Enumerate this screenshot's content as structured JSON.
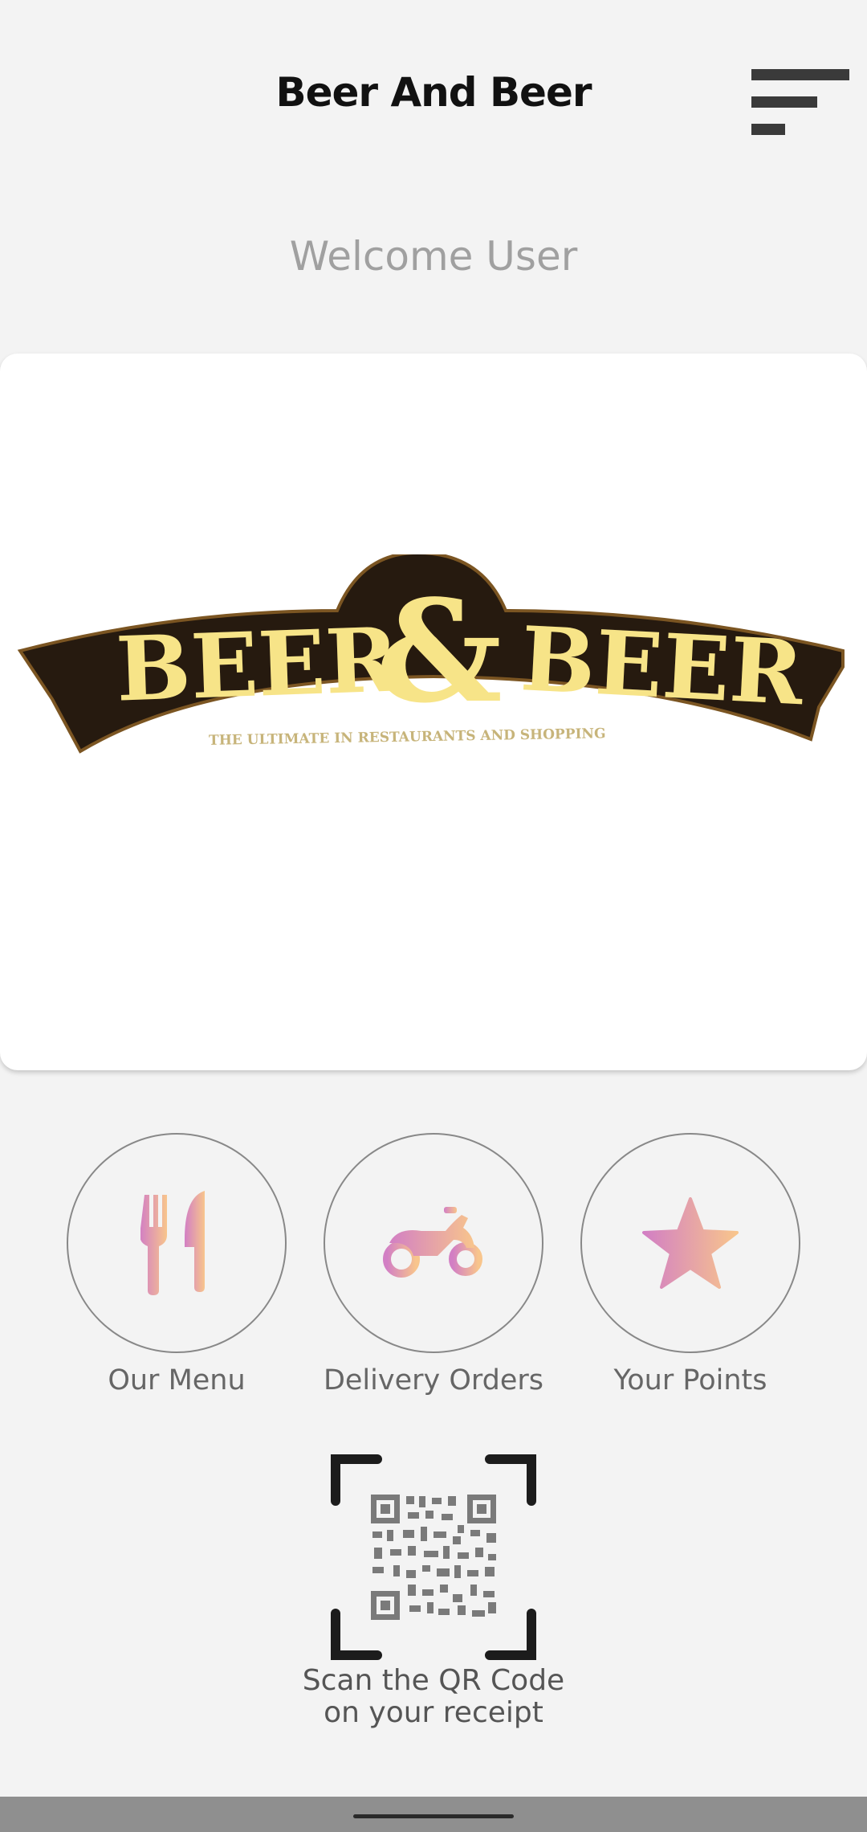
{
  "header": {
    "title": "Beer And Beer",
    "menu_icon": "hamburger-menu-icon"
  },
  "welcome_text": "Welcome User",
  "logo": {
    "main_text_left": "BEER",
    "ampersand": "&",
    "main_text_right": "BEER",
    "tagline": "THE ULTIMATE IN RESTAURANTS AND SHOPPING",
    "banner_color": "#261a0f",
    "text_color": "#f7e488"
  },
  "actions": [
    {
      "label": "Our Menu",
      "icon": "fork-knife-icon"
    },
    {
      "label": "Delivery Orders",
      "icon": "motorcycle-icon"
    },
    {
      "label": "Your Points",
      "icon": "star-icon"
    }
  ],
  "qr": {
    "caption_line1": "Scan the QR Code",
    "caption_line2": "on your receipt",
    "icon": "qr-code-scan-icon"
  },
  "colors": {
    "background": "#f3f3f3",
    "gradient_start": "#d27fc4",
    "gradient_end": "#f8c58c"
  }
}
